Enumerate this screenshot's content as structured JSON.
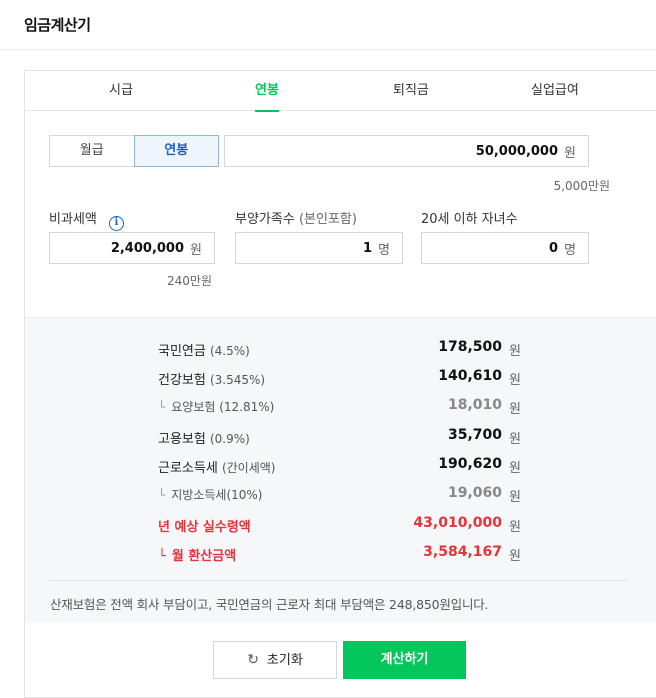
{
  "header": {
    "title": "임금계산기"
  },
  "tabs": [
    {
      "label": "시급",
      "active": false
    },
    {
      "label": "연봉",
      "active": true
    },
    {
      "label": "퇴직금",
      "active": false
    },
    {
      "label": "실업급여",
      "active": false
    }
  ],
  "salary": {
    "type_options": [
      "월급",
      "연봉"
    ],
    "selected": "연봉",
    "value": "50,000,000",
    "unit": "원",
    "hint": "5,000만원"
  },
  "fields": {
    "nontax": {
      "label": "비과세액",
      "value": "2,400,000",
      "unit": "원",
      "hint": "240만원",
      "info_icon": "info-icon"
    },
    "dependents": {
      "label": "부양가족수",
      "label_sub": "(본인포함)",
      "value": "1",
      "unit": "명"
    },
    "children": {
      "label": "20세 이하 자녀수",
      "value": "0",
      "unit": "명"
    }
  },
  "results": [
    {
      "name": "국민연금",
      "pct": "(4.5%)",
      "amount": "178,500",
      "unit": "원",
      "style": "main"
    },
    {
      "name": "건강보험",
      "pct": "(3.545%)",
      "amount": "140,610",
      "unit": "원",
      "style": "main"
    },
    {
      "name": "요양보험",
      "pct": "(12.81%)",
      "amount": "18,010",
      "unit": "원",
      "style": "sub"
    },
    {
      "name": "고용보험",
      "pct": "(0.9%)",
      "amount": "35,700",
      "unit": "원",
      "style": "main"
    },
    {
      "name": "근로소득세",
      "pct": "(간이세액)",
      "amount": "190,620",
      "unit": "원",
      "style": "main"
    },
    {
      "name": "지방소득세",
      "pct": "(10%)",
      "amount": "19,060",
      "unit": "원",
      "style": "sub"
    },
    {
      "name": "년 예상 실수령액",
      "pct": "",
      "amount": "43,010,000",
      "unit": "원",
      "style": "red"
    },
    {
      "name": "월 환산금액",
      "pct": "",
      "amount": "3,584,167",
      "unit": "원",
      "style": "red-sub"
    }
  ],
  "note": "산재보험은 전액 회사 부담이고, 국민연금의 근로자 최대 부담액은 248,850원입니다.",
  "buttons": {
    "reset": "초기화",
    "calculate": "계산하기"
  },
  "colors": {
    "accent": "#03c75a",
    "highlight": "#e5333a",
    "link": "#1b62c0"
  }
}
